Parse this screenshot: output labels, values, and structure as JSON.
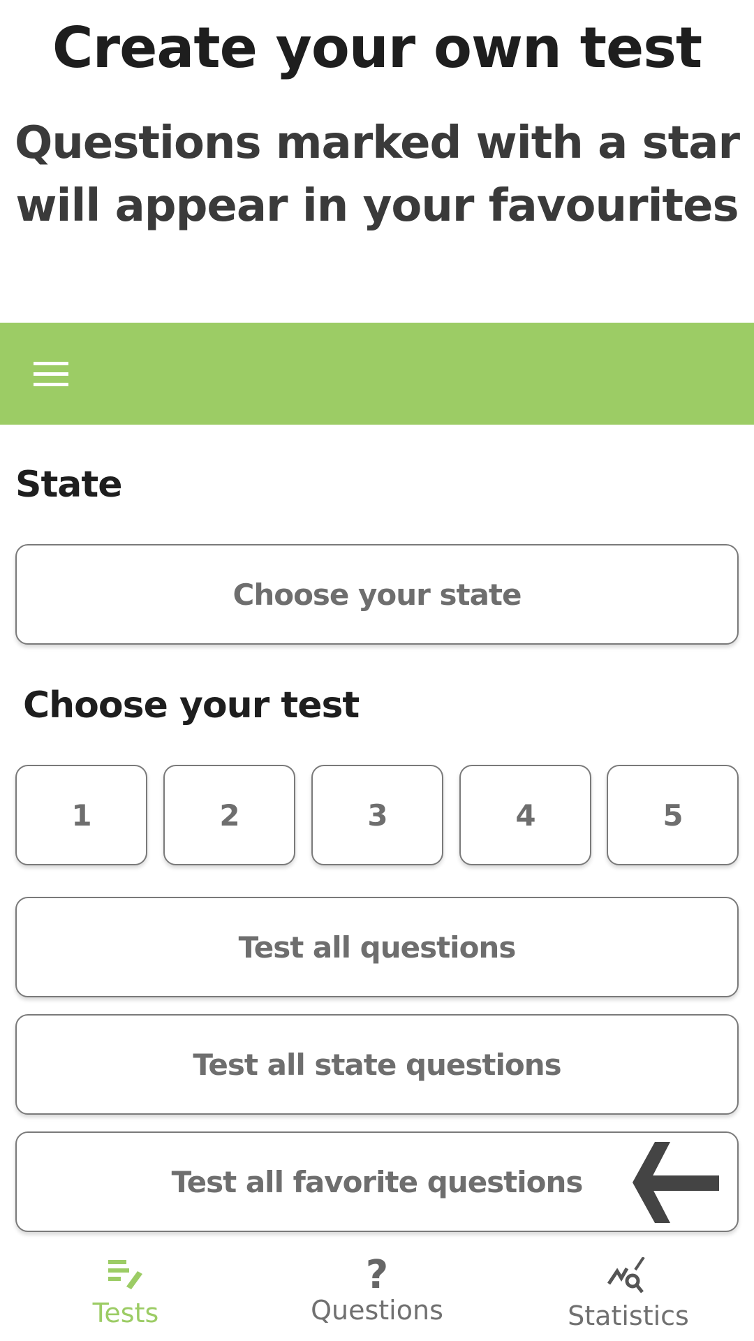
{
  "header": {
    "title": "Create your own test",
    "subtitle_line1": "Questions marked with a star",
    "subtitle_line2": "will appear in your favourites"
  },
  "toolbar": {
    "color": "#9ccc65",
    "menu_icon": "hamburger-icon"
  },
  "state": {
    "heading": "State",
    "select_label": "Choose your state"
  },
  "tests": {
    "heading": "Choose your test",
    "numbers": [
      "1",
      "2",
      "3",
      "4",
      "5"
    ],
    "all": "Test all questions",
    "all_state": "Test all state questions",
    "all_favorite": "Test all favorite questions"
  },
  "nav": {
    "items": [
      {
        "label": "Tests",
        "icon": "tests-edit-icon",
        "active": true
      },
      {
        "label": "Questions",
        "icon": "question-mark-icon"
      },
      {
        "label": "Statistics",
        "icon": "statistics-search-icon"
      }
    ]
  }
}
